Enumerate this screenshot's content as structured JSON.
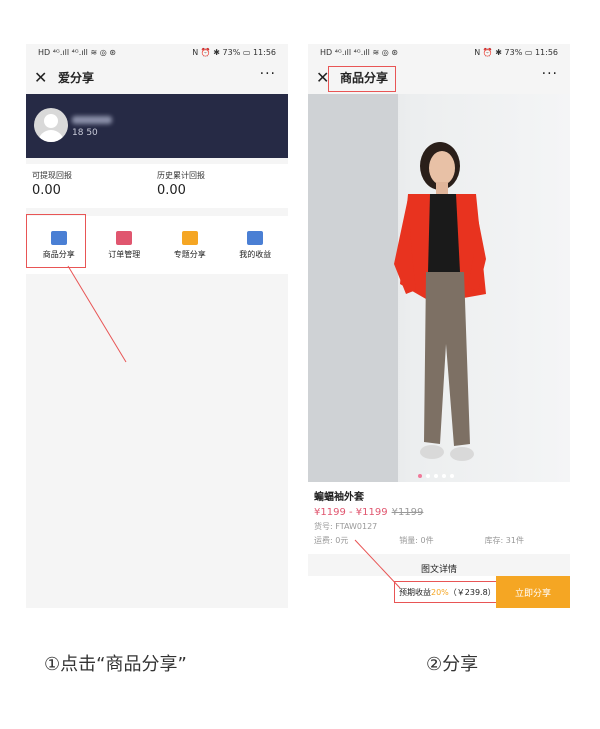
{
  "screen1": {
    "status": {
      "carrier": "HD ⁴ᴳ.ıll ⁴ᴳ.ıll ≋ ◎ ⊛",
      "right": "N ⏰ ✱ 73% ▭ 11:56"
    },
    "nav": {
      "close": "✕",
      "title": "爱分享",
      "more": "···"
    },
    "profile": {
      "phone_visible": "18        50"
    },
    "stats": [
      {
        "label": "可提现回报",
        "value": "0.00"
      },
      {
        "label": "历史累计回报",
        "value": "0.00"
      }
    ],
    "menu": [
      {
        "label": "商品分享",
        "icon": "share-bag-icon",
        "color": "#4a7fd4"
      },
      {
        "label": "订单管理",
        "icon": "order-icon",
        "color": "#e0566f"
      },
      {
        "label": "专题分享",
        "icon": "topic-icon",
        "color": "#f5a623"
      },
      {
        "label": "我的收益",
        "icon": "card-icon",
        "color": "#4a7fd4"
      }
    ]
  },
  "screen2": {
    "status": {
      "carrier": "HD ⁴ᴳ.ıll ⁴ᴳ.ıll ≋ ◎ ⊛",
      "right": "N ⏰ ✱ 73% ▭ 11:56"
    },
    "nav": {
      "close": "✕",
      "title": "商品分享",
      "more": "···"
    },
    "product": {
      "name": "蝙蝠袖外套",
      "price": "¥1199 - ¥1199",
      "old_price": "¥1199",
      "code": "货号: FTAW0127",
      "shipping": "运费: 0元",
      "sales": "销量: 0件",
      "stock": "库存: 31件"
    },
    "detail_title": "图文详情",
    "earn": {
      "label": "预期收益",
      "pct": "20%",
      "amount": "（￥239.8）"
    },
    "share_button": "立即分享"
  },
  "captions": {
    "step1": "①点击“商品分享”",
    "step2": "②分享"
  },
  "colors": {
    "accent": "#f5a623",
    "highlight": "#e85555",
    "price": "#e0566f",
    "header": "#262a45"
  }
}
